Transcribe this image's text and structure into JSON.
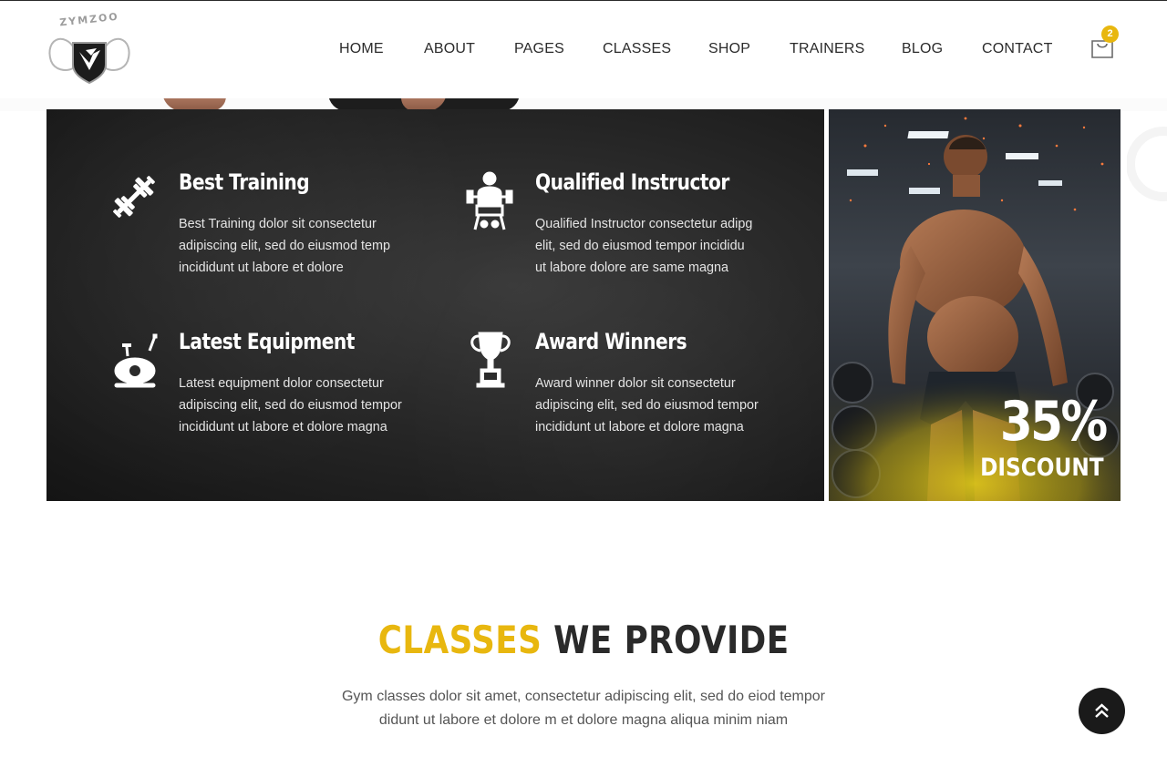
{
  "brand": {
    "logo_text": "ZYMZOO"
  },
  "nav": {
    "items": [
      {
        "label": "HOME"
      },
      {
        "label": "ABOUT"
      },
      {
        "label": "PAGES"
      },
      {
        "label": "CLASSES"
      },
      {
        "label": "SHOP"
      },
      {
        "label": "TRAINERS"
      },
      {
        "label": "BLOG"
      },
      {
        "label": "CONTACT"
      }
    ],
    "cart_count": "2"
  },
  "features": [
    {
      "icon": "dumbbell-icon",
      "title": "Best Training",
      "lines": [
        "Best Training dolor sit consectetur",
        "adipiscing elit, sed do eiusmod temp",
        "incididunt ut labore et dolore"
      ]
    },
    {
      "icon": "instructor-icon",
      "title": "Qualified Instructor",
      "lines": [
        "Qualified Instructor consectetur adipg",
        "elit, sed do eiusmod tempor incididu",
        "ut labore dolore are same magna"
      ]
    },
    {
      "icon": "exercise-bike-icon",
      "title": "Latest Equipment",
      "lines": [
        "Latest equipment dolor consectetur",
        "adipiscing elit, sed do eiusmod tempor",
        "incididunt ut labore et dolore magna"
      ]
    },
    {
      "icon": "trophy-icon",
      "title": "Award Winners",
      "lines": [
        "Award winner dolor sit consectetur",
        "adipiscing elit, sed do eiusmod tempor",
        "incididunt ut labore et dolore magna"
      ]
    }
  ],
  "promo": {
    "percent": "35%",
    "label": "DISCOUNT"
  },
  "classes_section": {
    "title_accent": "CLASSES",
    "title_rest": "WE PROVIDE",
    "desc_lines": [
      "Gym classes dolor sit amet, consectetur adipiscing elit, sed do eiod tempor",
      "didunt ut labore et dolore m et dolore magna aliqua minim niam"
    ]
  },
  "colors": {
    "accent": "#e8b70f",
    "dark": "#2a2a2a",
    "panel": "#242424"
  }
}
